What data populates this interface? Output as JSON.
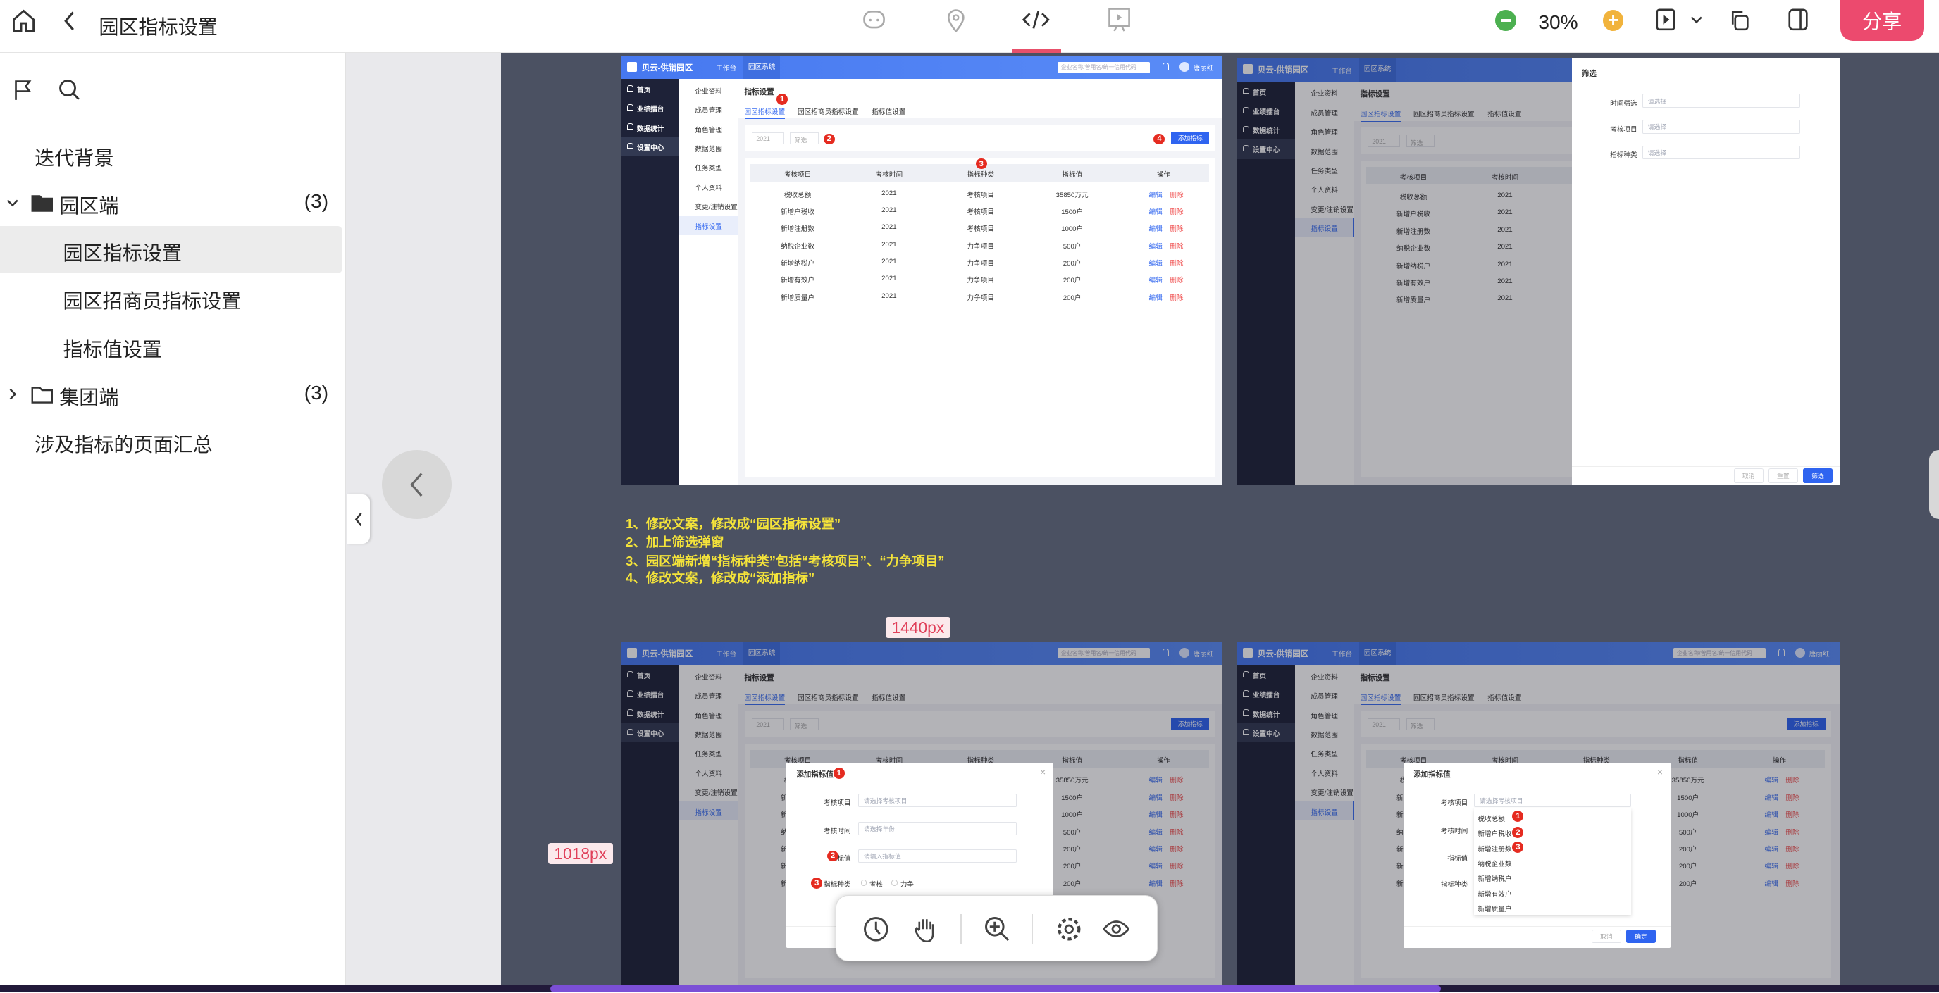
{
  "topbar": {
    "title": "园区指标设置",
    "zoom": "30%",
    "share_label": "分享",
    "icons": [
      "home-icon",
      "back-icon",
      "comment-icon",
      "location-icon",
      "code-icon",
      "presentation-icon",
      "zoom-out-icon",
      "zoom-in-icon",
      "play-icon",
      "chevron-down-icon",
      "copy-icon",
      "panel-icon"
    ],
    "accent": "#ec4a6e"
  },
  "sidebar": {
    "items": [
      {
        "label": "迭代背景",
        "level": 0
      },
      {
        "label": "园区端",
        "level": 0,
        "folder": true,
        "expanded": true,
        "count": "(3)"
      },
      {
        "label": "园区指标设置",
        "level": 1,
        "selected": true
      },
      {
        "label": "园区招商员指标设置",
        "level": 1
      },
      {
        "label": "指标值设置",
        "level": 1
      },
      {
        "label": "集团端",
        "level": 0,
        "folder": true,
        "expanded": false,
        "count": "(3)"
      },
      {
        "label": "涉及指标的页面汇总",
        "level": 0
      }
    ]
  },
  "canvas": {
    "notes": [
      "1、修改文案，修改成“园区指标设置”",
      "2、加上筛选弹窗",
      "3、园区端新增“指标种类”包括“考核项目”、“力争项目”",
      "4、修改文案，修改成“添加指标”"
    ],
    "width_label": "1440px",
    "height_label": "1018px"
  },
  "app": {
    "title": "贝云-供销园区",
    "top_tabs": [
      "工作台",
      "园区系统"
    ],
    "search_placeholder": "企业名称/曾用名/统一信用代码",
    "user": "唐丽红",
    "nav": [
      "首页",
      "业绩擂台",
      "数据统计",
      "设置中心"
    ],
    "nav_active": 3,
    "subnav": [
      "企业资料",
      "成员管理",
      "角色管理",
      "数据范围",
      "任务类型",
      "个人资料",
      "变更/注销设置",
      "指标设置"
    ],
    "subnav_active": 7,
    "page_title": "指标设置",
    "tabs": [
      "园区指标设置",
      "园区招商员指标设置",
      "指标值设置"
    ],
    "year": "2021",
    "filter": "筛选",
    "add_button": "添加指标",
    "columns": [
      "考核项目",
      "考核时间",
      "指标种类",
      "指标值",
      "操作"
    ],
    "rows": [
      [
        "税收总额",
        "2021",
        "考核项目",
        "35850万元"
      ],
      [
        "新增户税收",
        "2021",
        "考核项目",
        "1500户"
      ],
      [
        "新增注册数",
        "2021",
        "考核项目",
        "1000户"
      ],
      [
        "纳税企业数",
        "2021",
        "力争项目",
        "500户"
      ],
      [
        "新增纳税户",
        "2021",
        "力争项目",
        "200户"
      ],
      [
        "新增有效户",
        "2021",
        "力争项目",
        "200户"
      ],
      [
        "新增质量户",
        "2021",
        "力争项目",
        "200户"
      ]
    ],
    "edit": "编辑",
    "delete": "删除",
    "primary": "#2f64f0",
    "danger": "#f05050"
  },
  "drawer": {
    "title": "筛选",
    "fields": [
      {
        "label": "时间筛选",
        "placeholder": "请选择"
      },
      {
        "label": "考核项目",
        "placeholder": "请选择"
      },
      {
        "label": "指标种类",
        "placeholder": "请选择"
      }
    ],
    "cancel": "取消",
    "reset": "重置",
    "confirm": "筛选"
  },
  "modal": {
    "title": "添加指标值",
    "labels": [
      "考核项目",
      "考核时间",
      "指标值",
      "指标种类"
    ],
    "placeholders": [
      "请选择考核项目",
      "请选择年份",
      "请输入指标值"
    ],
    "radios": [
      "考核",
      "力争"
    ],
    "options": [
      "税收总额",
      "新增户税收",
      "新增注册数",
      "纳税企业数",
      "新增纳税户",
      "新增有效户",
      "新增质量户"
    ],
    "cancel": "取消",
    "confirm": "确定"
  },
  "toolbar": {
    "icons": [
      "history-icon",
      "hand-icon",
      "zoom-icon",
      "settings-icon",
      "preview-icon"
    ]
  }
}
